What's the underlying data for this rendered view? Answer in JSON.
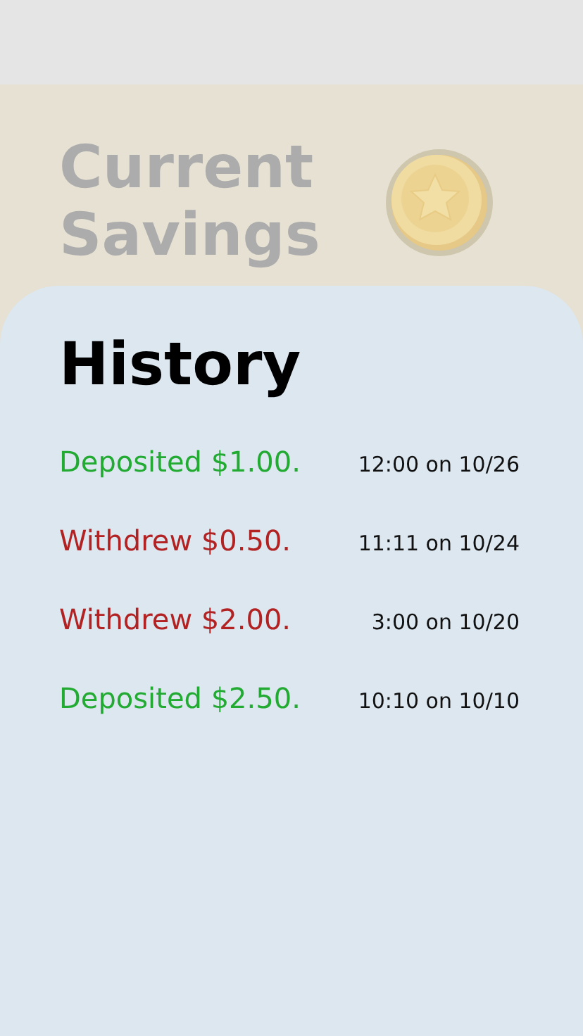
{
  "header": {
    "title_lines": [
      "Current",
      "Savings"
    ]
  },
  "history": {
    "title": "History",
    "entries": [
      {
        "kind": "deposit",
        "text": "Deposited $1.00.",
        "time": "12:00 on 10/26"
      },
      {
        "kind": "withdrawal",
        "text": "Withdrew $0.50.",
        "time": "11:11 on 10/24"
      },
      {
        "kind": "withdrawal",
        "text": "Withdrew $2.00.",
        "time": "3:00 on 10/20"
      },
      {
        "kind": "deposit",
        "text": "Deposited $2.50.",
        "time": "10:10 on 10/10"
      }
    ]
  }
}
